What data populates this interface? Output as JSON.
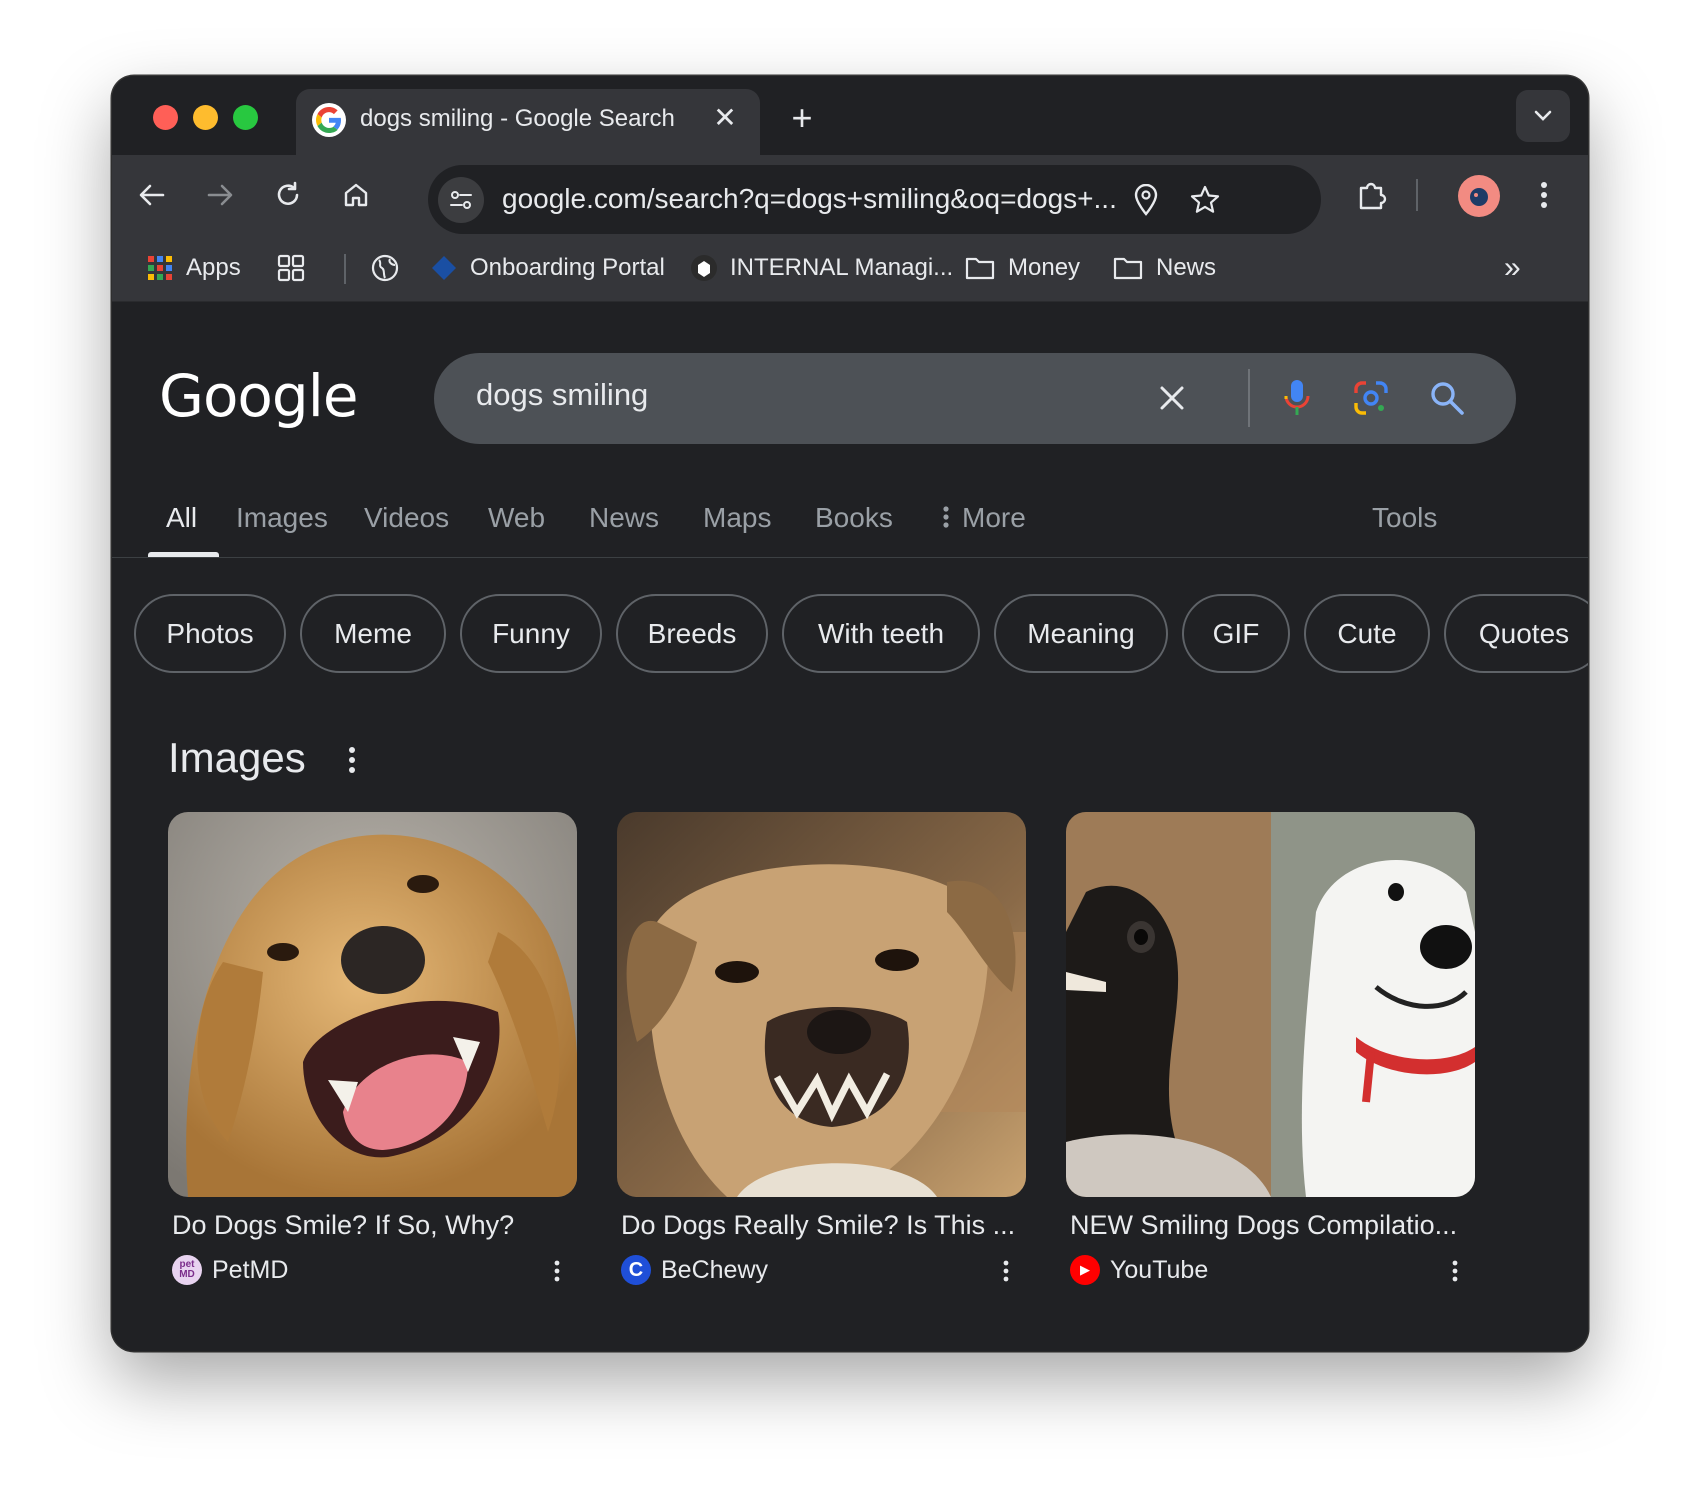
{
  "browser": {
    "tab_title": "dogs smiling - Google Search",
    "tab_close": "✕",
    "new_tab": "+",
    "url": "google.com/search?q=dogs+smiling&oq=dogs+...",
    "bookmarks": [
      {
        "label": "Apps",
        "icon": "apps-grid-icon"
      },
      {
        "label": "",
        "icon": "tab-groups-icon"
      },
      {
        "label": "",
        "icon": "globe-icon"
      },
      {
        "label": "Onboarding Portal",
        "icon": "diamond-icon"
      },
      {
        "label": "INTERNAL Managi...",
        "icon": "badge-icon"
      },
      {
        "label": "Money",
        "icon": "folder-icon"
      },
      {
        "label": "News",
        "icon": "folder-icon"
      }
    ],
    "overflow": "»"
  },
  "google": {
    "logo": "Google",
    "query": "dogs smiling",
    "nav_tabs": [
      "All",
      "Images",
      "Videos",
      "Web",
      "News",
      "Maps",
      "Books"
    ],
    "more_label": "More",
    "tools_label": "Tools",
    "chips": [
      "Photos",
      "Meme",
      "Funny",
      "Breeds",
      "With teeth",
      "Meaning",
      "GIF",
      "Cute",
      "Quotes"
    ],
    "images_heading": "Images",
    "results": [
      {
        "caption": "Do Dogs Smile? If So, Why?",
        "source": "PetMD",
        "source_icon_text": "pet MD"
      },
      {
        "caption": "Do Dogs Really Smile? Is This ...",
        "source": "BeChewy",
        "source_icon_text": "C"
      },
      {
        "caption": "NEW Smiling Dogs Compilatio...",
        "source": "YouTube",
        "source_icon_text": "▶"
      }
    ]
  },
  "colors": {
    "page_bg": "#202124",
    "toolbar_bg": "#35363a",
    "search_box_bg": "#4d5156",
    "text": "#e8eaed",
    "muted_text": "#9aa0a6",
    "chip_border": "#5f6368"
  }
}
